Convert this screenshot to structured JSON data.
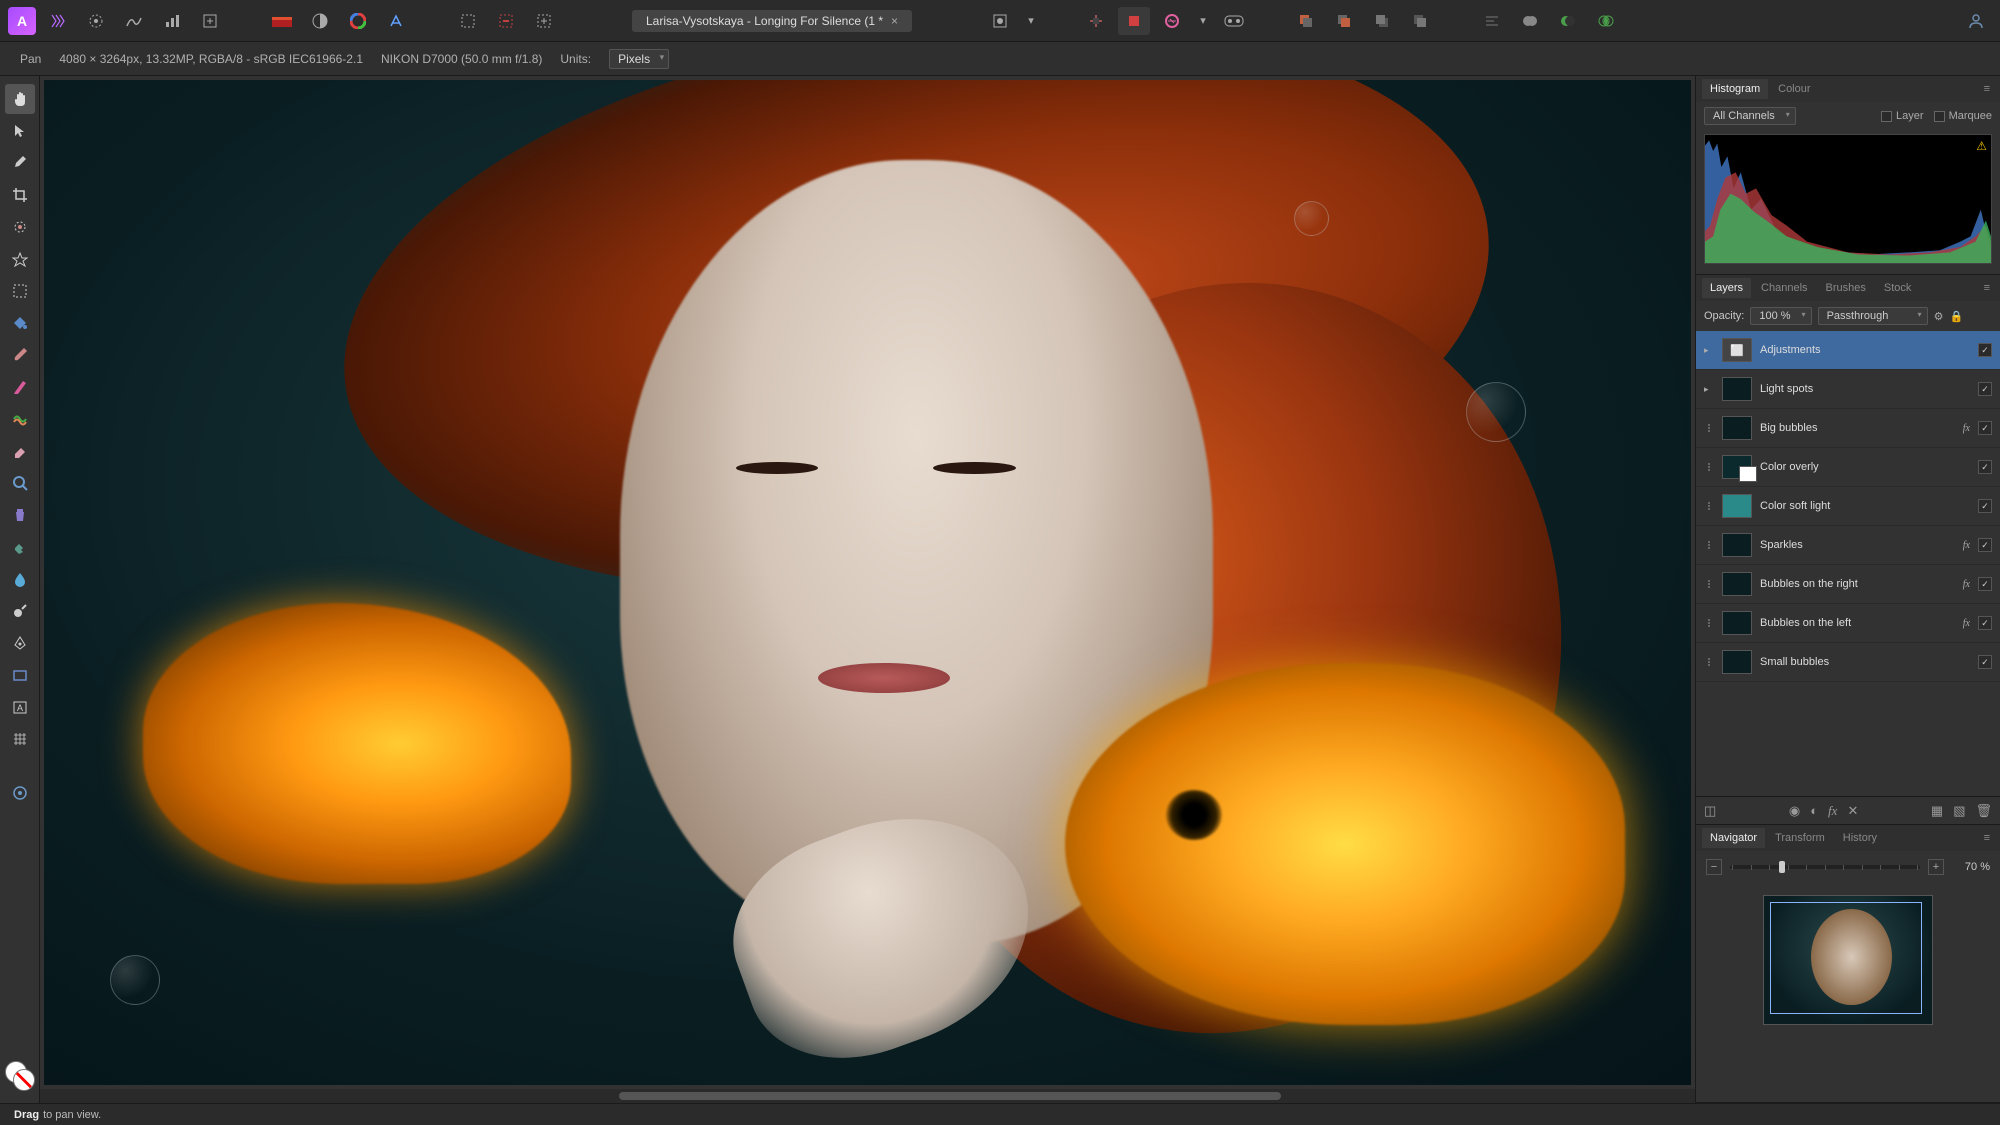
{
  "doc": {
    "title": "Larisa-Vysotskaya - Longing For Silence (1 *"
  },
  "context": {
    "tool": "Pan",
    "info": "4080 × 3264px, 13.32MP, RGBA/8 - sRGB IEC61966-2.1",
    "camera": "NIKON D7000 (50.0 mm f/1.8)",
    "units_label": "Units:",
    "units_value": "Pixels"
  },
  "histogram": {
    "tabs": [
      "Histogram",
      "Colour"
    ],
    "channels": "All Channels",
    "layer_label": "Layer",
    "marquee_label": "Marquee"
  },
  "layers_panel": {
    "tabs": [
      "Layers",
      "Channels",
      "Brushes",
      "Stock"
    ],
    "opacity_label": "Opacity:",
    "opacity_value": "100 %",
    "blend_mode": "Passthrough",
    "items": [
      {
        "name": "Adjustments",
        "selected": true,
        "thumb": "adj",
        "fx": false,
        "visible": true,
        "expand": true
      },
      {
        "name": "Light spots",
        "thumb": "dark",
        "fx": false,
        "visible": true,
        "expand": true
      },
      {
        "name": "Big bubbles",
        "thumb": "dark",
        "fx": true,
        "visible": true,
        "dots": true
      },
      {
        "name": "Color overly",
        "thumb": "mask",
        "fx": false,
        "visible": true,
        "dots": true
      },
      {
        "name": "Color soft light",
        "thumb": "teal",
        "fx": false,
        "visible": true,
        "dots": true
      },
      {
        "name": "Sparkles",
        "thumb": "dark",
        "fx": true,
        "visible": true,
        "dots": true
      },
      {
        "name": "Bubbles on the right",
        "thumb": "dark",
        "fx": true,
        "visible": true,
        "dots": true
      },
      {
        "name": "Bubbles on the left",
        "thumb": "dark",
        "fx": true,
        "visible": true,
        "dots": true
      },
      {
        "name": "Small bubbles",
        "thumb": "dark",
        "fx": false,
        "visible": true,
        "dots": true
      }
    ]
  },
  "navigator": {
    "tabs": [
      "Navigator",
      "Transform",
      "History"
    ],
    "zoom": "70 %"
  },
  "status": {
    "strong": "Drag",
    "rest": "to pan view."
  }
}
